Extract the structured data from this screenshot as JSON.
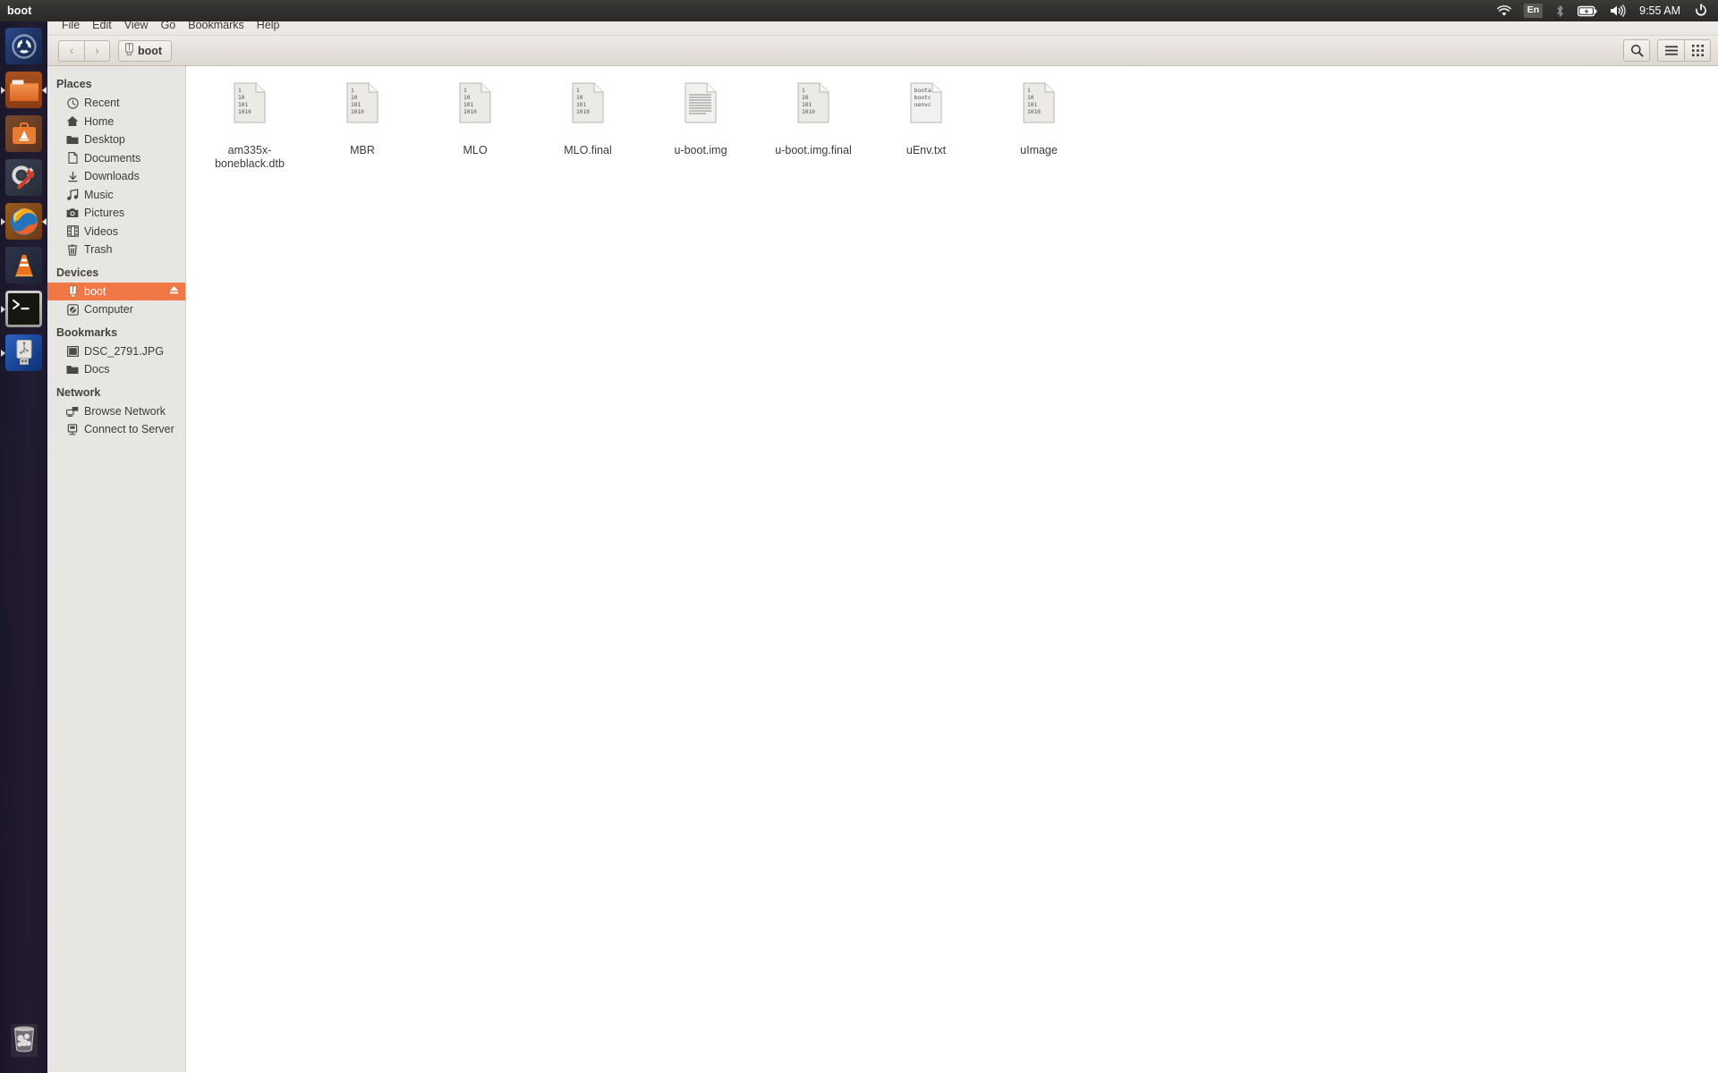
{
  "panel": {
    "title": "boot",
    "indicators": [
      {
        "name": "wifi-icon",
        "label": "wifi"
      },
      {
        "name": "keyboard-layout-indicator",
        "label": "En"
      },
      {
        "name": "bluetooth-icon",
        "label": "bluetooth"
      },
      {
        "name": "battery-icon",
        "label": "battery-charging"
      },
      {
        "name": "volume-icon",
        "label": "volume"
      }
    ],
    "clock": "9:55 AM",
    "session_menu": "system-gear-icon"
  },
  "launcher": {
    "items": [
      {
        "name": "launcher-ubuntu-dash",
        "label": "Ubuntu Dash",
        "running": false
      },
      {
        "name": "launcher-files",
        "label": "Files",
        "running": true
      },
      {
        "name": "launcher-software-center",
        "label": "Ubuntu Software Center",
        "running": false
      },
      {
        "name": "launcher-system-settings",
        "label": "System Settings",
        "running": false
      },
      {
        "name": "launcher-firefox",
        "label": "Firefox Web Browser",
        "running": true
      },
      {
        "name": "launcher-vlc",
        "label": "VLC media player",
        "running": false
      },
      {
        "name": "launcher-terminal",
        "label": "Terminal",
        "running": true
      },
      {
        "name": "launcher-usb-drive",
        "label": "boot",
        "running": false
      }
    ],
    "trash": {
      "name": "launcher-trash",
      "label": "Trash"
    }
  },
  "menubar": {
    "items": [
      "File",
      "Edit",
      "View",
      "Go",
      "Bookmarks",
      "Help"
    ]
  },
  "toolbar": {
    "back_label": "‹",
    "forward_label": "›",
    "path_label": "boot",
    "search_label": "search-icon",
    "list_view_label": "list-view-icon",
    "grid_view_label": "grid-view-icon"
  },
  "sidebar": {
    "sections": [
      {
        "heading": "Places",
        "items": [
          {
            "label": "Recent",
            "icon": "clock-icon",
            "selected": false
          },
          {
            "label": "Home",
            "icon": "home-icon",
            "selected": false
          },
          {
            "label": "Desktop",
            "icon": "folder-icon",
            "selected": false
          },
          {
            "label": "Documents",
            "icon": "document-icon",
            "selected": false
          },
          {
            "label": "Downloads",
            "icon": "download-icon",
            "selected": false
          },
          {
            "label": "Music",
            "icon": "music-note-icon",
            "selected": false
          },
          {
            "label": "Pictures",
            "icon": "camera-icon",
            "selected": false
          },
          {
            "label": "Videos",
            "icon": "film-icon",
            "selected": false
          },
          {
            "label": "Trash",
            "icon": "trash-icon",
            "selected": false
          }
        ]
      },
      {
        "heading": "Devices",
        "items": [
          {
            "label": "boot",
            "icon": "usb-drive-icon",
            "selected": true,
            "eject": true
          },
          {
            "label": "Computer",
            "icon": "computer-icon",
            "selected": false
          }
        ]
      },
      {
        "heading": "Bookmarks",
        "items": [
          {
            "label": "DSC_2791.JPG",
            "icon": "image-icon",
            "selected": false
          },
          {
            "label": "Docs",
            "icon": "folder-icon",
            "selected": false
          }
        ]
      },
      {
        "heading": "Network",
        "items": [
          {
            "label": "Browse Network",
            "icon": "network-icon",
            "selected": false
          },
          {
            "label": "Connect to Server",
            "icon": "server-icon",
            "selected": false
          }
        ]
      }
    ]
  },
  "files": {
    "binary_icon_lines": [
      "1",
      "10",
      "101",
      "1010"
    ],
    "text_icon_lines": [
      "boota",
      "bootc",
      "uenvc"
    ],
    "items": [
      {
        "name": "am335x-boneblack.dtb",
        "icon": "binary-file-icon"
      },
      {
        "name": "MBR",
        "icon": "binary-file-icon"
      },
      {
        "name": "MLO",
        "icon": "binary-file-icon"
      },
      {
        "name": "MLO.final",
        "icon": "binary-file-icon"
      },
      {
        "name": "u-boot.img",
        "icon": "document-file-icon"
      },
      {
        "name": "u-boot.img.final",
        "icon": "binary-file-icon"
      },
      {
        "name": "uEnv.txt",
        "icon": "text-file-icon"
      },
      {
        "name": "uImage",
        "icon": "binary-file-icon"
      }
    ]
  },
  "colors": {
    "accent": "#f07746",
    "panel": "#333230",
    "sidebar_bg": "#e8e6e3",
    "toolbar_bg": "#e4dfda"
  }
}
